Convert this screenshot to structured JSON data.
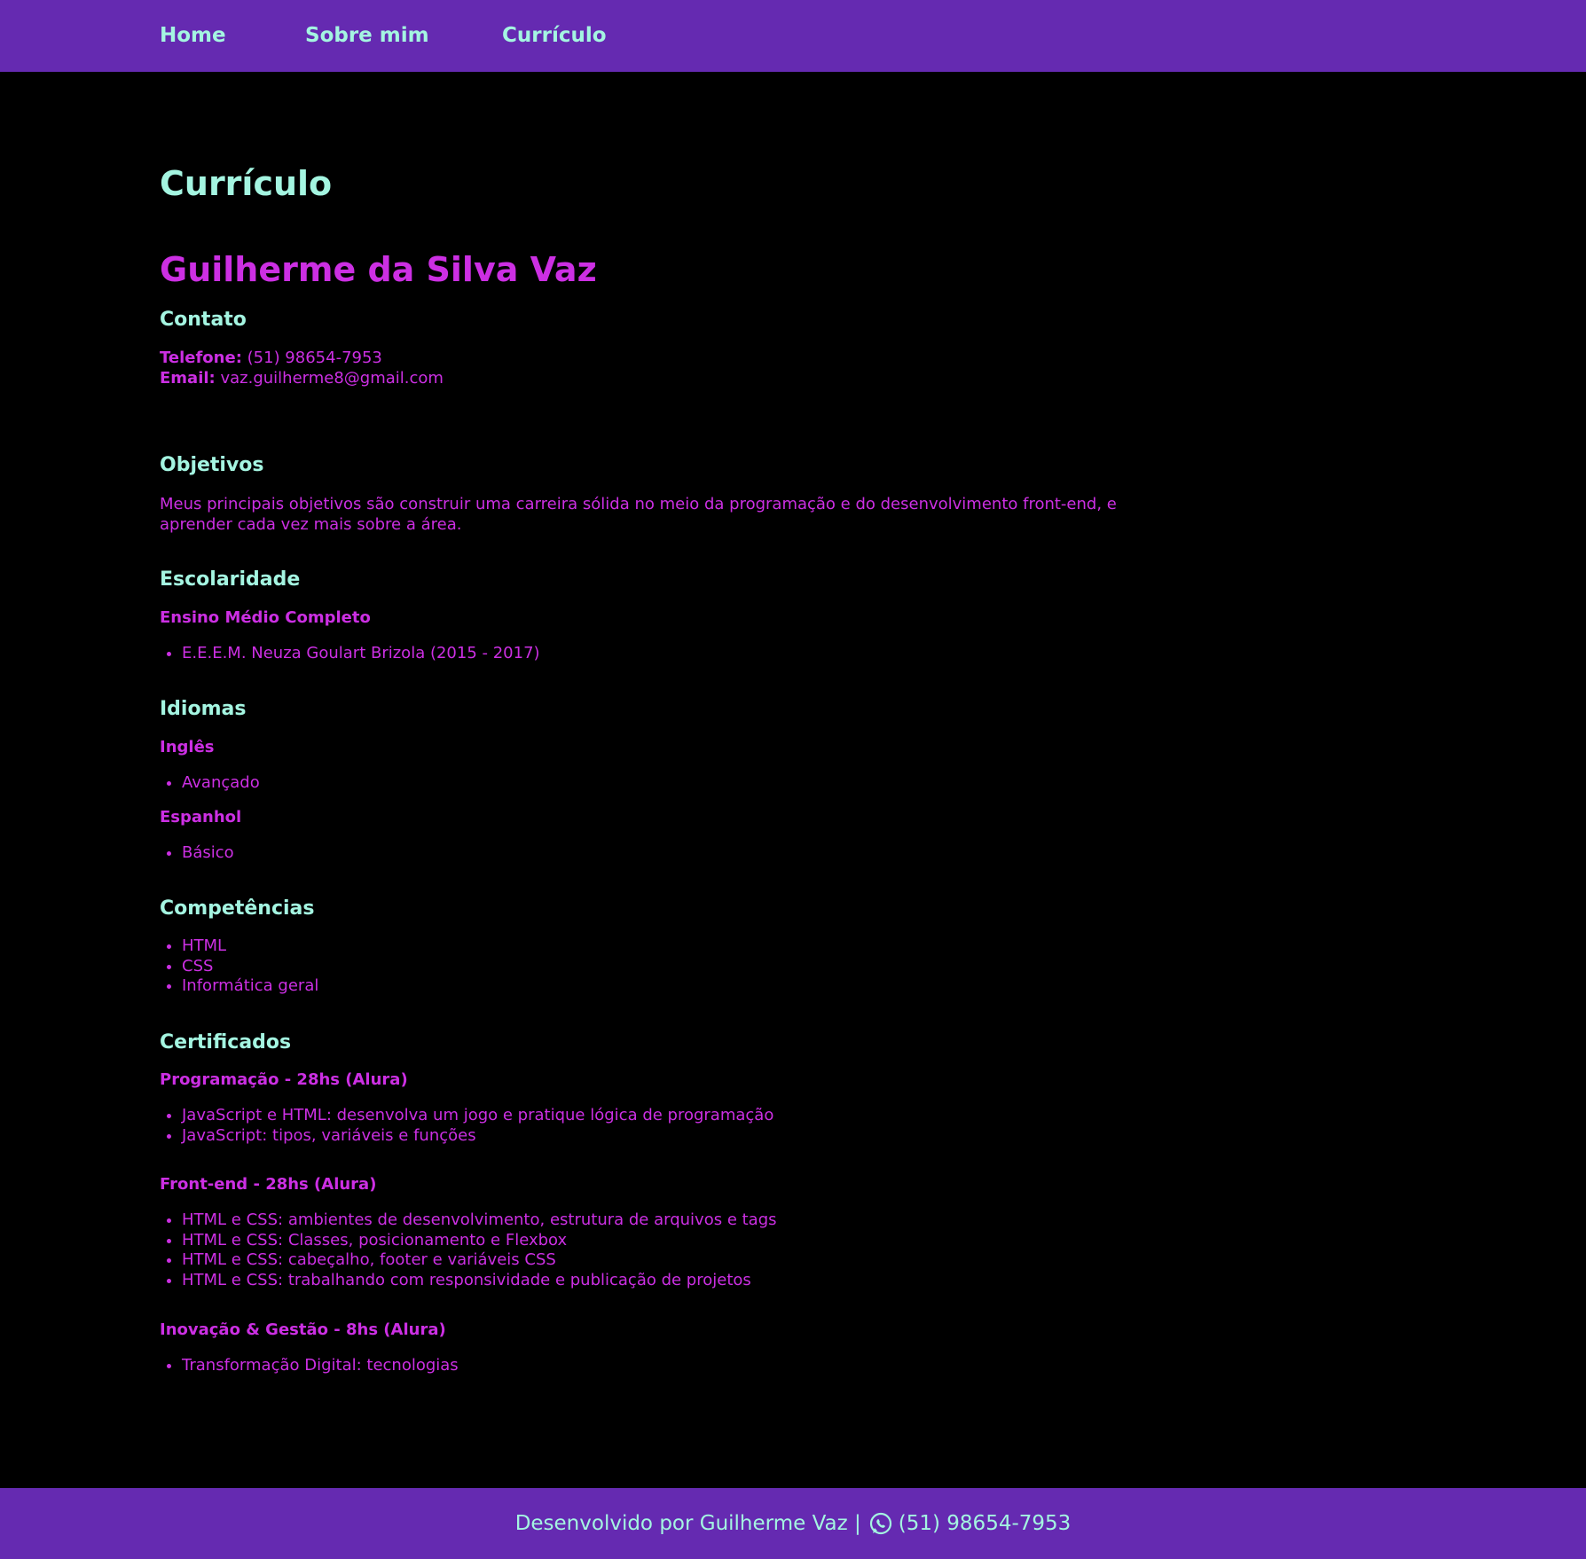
{
  "nav": {
    "home": "Home",
    "about": "Sobre mim",
    "resume": "Currículo"
  },
  "page_title": "Currículo",
  "name": "Guilherme da Silva Vaz",
  "contact": {
    "heading": "Contato",
    "phone_label": "Telefone:",
    "phone_value": "(51) 98654-7953",
    "email_label": "Email:",
    "email_value": "vaz.guilherme8@gmail.com"
  },
  "objectives": {
    "heading": "Objetivos",
    "text": "Meus principais objetivos são construir uma carreira sólida no meio da programação e do desenvolvimento front-end, e aprender cada vez mais sobre a área."
  },
  "education": {
    "heading": "Escolaridade",
    "subheading": "Ensino Médio Completo",
    "items": [
      "E.E.E.M. Neuza Goulart Brizola (2015 - 2017)"
    ]
  },
  "languages": {
    "heading": "Idiomas",
    "english": {
      "label": "Inglês",
      "level": "Avançado"
    },
    "spanish": {
      "label": "Espanhol",
      "level": "Básico"
    }
  },
  "skills": {
    "heading": "Competências",
    "items": [
      "HTML",
      "CSS",
      "Informática geral"
    ]
  },
  "certificates": {
    "heading": "Certificados",
    "groups": [
      {
        "title": "Programação - 28hs (Alura)",
        "items": [
          "JavaScript e HTML: desenvolva um jogo e pratique lógica de programação",
          "JavaScript: tipos, variáveis e funções"
        ]
      },
      {
        "title": "Front-end - 28hs (Alura)",
        "items": [
          "HTML e CSS: ambientes de desenvolvimento, estrutura de arquivos e tags",
          "HTML e CSS: Classes, posicionamento e Flexbox",
          "HTML e CSS: cabeçalho, footer e variáveis CSS",
          "HTML e CSS: trabalhando com responsividade e publicação de projetos"
        ]
      },
      {
        "title": "Inovação & Gestão - 8hs (Alura)",
        "items": [
          "Transformação Digital: tecnologias"
        ]
      }
    ]
  },
  "footer": {
    "text": "Desenvolvido por Guilherme Vaz |",
    "icon": "whatsapp-icon",
    "phone": "(51) 98654-7953"
  },
  "colors": {
    "header_bg": "#652ab1",
    "page_bg": "#000000",
    "accent_mint": "#a4f5e1",
    "accent_magenta": "#cc2fe3"
  }
}
